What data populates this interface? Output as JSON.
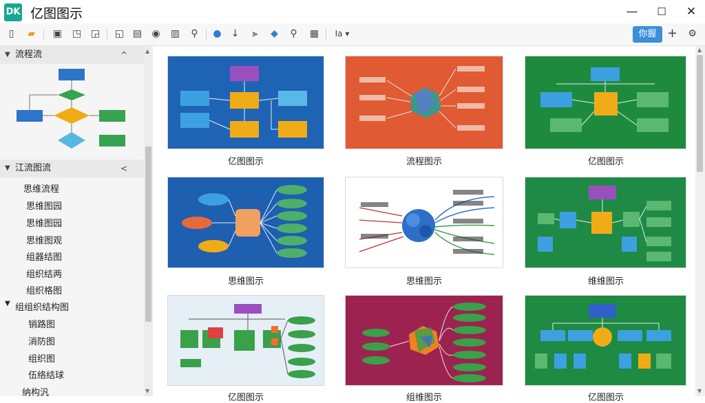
{
  "app": {
    "logo_text": "DK",
    "title": "亿图图示"
  },
  "window": {
    "minimize_icon": "—",
    "maximize_icon": "☐",
    "close_icon": "✕"
  },
  "toolbar": {
    "share_label": "你握",
    "add_icon": "+",
    "settings_icon": "gear-icon",
    "font_size_label": "Ia"
  },
  "sidebar": {
    "flowchart_section": {
      "label": "流程流",
      "collapse_icon": "^"
    },
    "mind_section": {
      "label": "江流图流",
      "collapse_icon": "<"
    },
    "mind_items": [
      "思维流程",
      "思维图园",
      "思维图园",
      "思维图观",
      "组器结图",
      "组织结两",
      "组织格图"
    ],
    "org_section": {
      "label": "组组织结构图"
    },
    "org_items": [
      "销路图",
      "消防图",
      "组织图",
      "伍络结球"
    ],
    "last_item": "纳构汎"
  },
  "gallery": {
    "cards": [
      {
        "label": "亿图图示",
        "bg": "#1f63b5"
      },
      {
        "label": "流程图示",
        "bg": "#e05a34"
      },
      {
        "label": "亿图图示",
        "bg": "#1e8a3e"
      },
      {
        "label": "思维图示",
        "bg": "#1e5fb0"
      },
      {
        "label": "思维图示",
        "bg": "#ffffff"
      },
      {
        "label": "维维图示",
        "bg": "#1f8a45"
      },
      {
        "label": "亿图图示",
        "bg": "#e6eef6"
      },
      {
        "label": "组维图示",
        "bg": "#9c2350"
      },
      {
        "label": "亿图图示",
        "bg": "#1e8a42"
      }
    ]
  }
}
